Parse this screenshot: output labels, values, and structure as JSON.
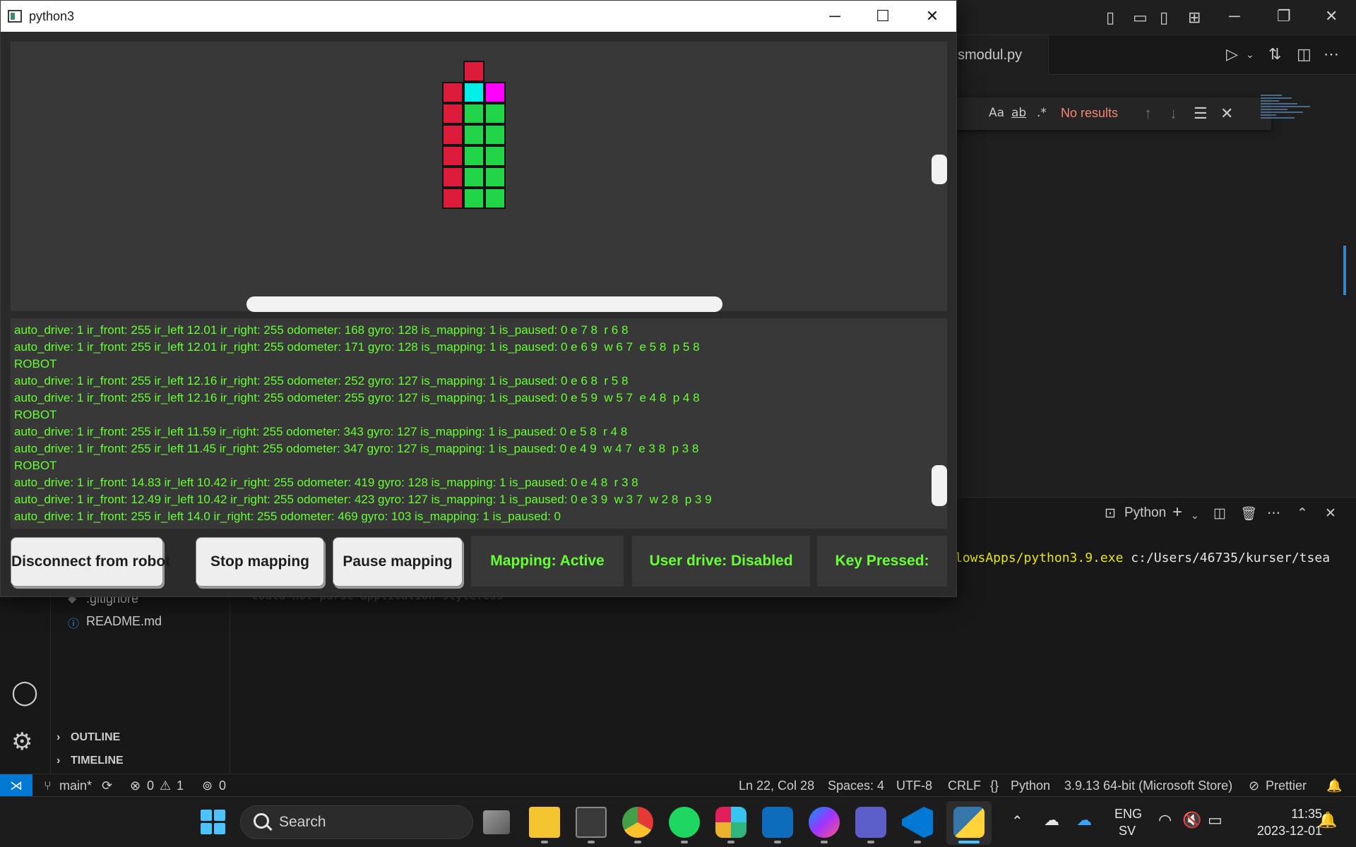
{
  "vscode": {
    "editor_tab": "smodul.py",
    "find": {
      "case_label": "Aa",
      "word_label": "ab",
      "regex_label": ".*",
      "no_results": "No results"
    },
    "explorer_files": [
      ".gitignore",
      "README.md"
    ],
    "sections": {
      "outline": "OUTLINE",
      "timeline": "TIMELINE"
    },
    "panel": {
      "shell_label": "Python",
      "cmd_path": "lowsApps/python3.9.exe",
      "cmd_arg": "c:/Users/46735/kurser/tsea",
      "faded_text": "could not parse application style.css"
    },
    "statusbar": {
      "branch": "main*",
      "errors": "0",
      "warnings": "1",
      "ports": "0",
      "position": "Ln 22, Col 28",
      "spaces": "Spaces: 4",
      "encoding": "UTF-8",
      "eol": "CRLF",
      "language": "Python",
      "interpreter": "3.9.13 64-bit (Microsoft Store)",
      "formatter": "Prettier"
    }
  },
  "taskbar": {
    "search_placeholder": "Search",
    "lang_1": "ENG",
    "lang_2": "SV",
    "time": "11:35",
    "date": "2023-12-01"
  },
  "pywin": {
    "title": "python3",
    "log_lines": [
      "auto_drive: 1 ir_front: 255 ir_left 12.01 ir_right: 255 odometer: 168 gyro: 128 is_mapping: 1 is_paused: 0 e 7 8  r 6 8",
      "auto_drive: 1 ir_front: 255 ir_left 12.01 ir_right: 255 odometer: 171 gyro: 128 is_mapping: 1 is_paused: 0 e 6 9  w 6 7  e 5 8  p 5 8",
      "ROBOT",
      "auto_drive: 1 ir_front: 255 ir_left 12.16 ir_right: 255 odometer: 252 gyro: 127 is_mapping: 1 is_paused: 0 e 6 8  r 5 8",
      "auto_drive: 1 ir_front: 255 ir_left 12.16 ir_right: 255 odometer: 255 gyro: 127 is_mapping: 1 is_paused: 0 e 5 9  w 5 7  e 4 8  p 4 8",
      "ROBOT",
      "auto_drive: 1 ir_front: 255 ir_left 11.59 ir_right: 255 odometer: 343 gyro: 127 is_mapping: 1 is_paused: 0 e 5 8  r 4 8",
      "auto_drive: 1 ir_front: 255 ir_left 11.45 ir_right: 255 odometer: 347 gyro: 127 is_mapping: 1 is_paused: 0 e 4 9  w 4 7  e 3 8  p 3 8",
      "ROBOT",
      "auto_drive: 1 ir_front: 14.83 ir_left 10.42 ir_right: 255 odometer: 419 gyro: 128 is_mapping: 1 is_paused: 0 e 4 8  r 3 8",
      "auto_drive: 1 ir_front: 12.49 ir_left 10.42 ir_right: 255 odometer: 423 gyro: 127 is_mapping: 1 is_paused: 0 e 3 9  w 3 7  w 2 8  p 3 9",
      "auto_drive: 1 ir_front: 255 ir_left 14.0 ir_right: 255 odometer: 469 gyro: 103 is_mapping: 1 is_paused: 0"
    ],
    "buttons": {
      "disconnect": "Disconnect from robot",
      "stop_mapping": "Stop mapping",
      "pause_mapping": "Pause mapping"
    },
    "status": {
      "mapping": "Mapping: Active",
      "user_drive": "User drive: Disabled",
      "key_pressed": "Key Pressed:"
    },
    "map_colors": {
      "wall": "#dc1c3a",
      "empty": "#22d447",
      "robot": "#00f0e8",
      "target": "#ff00ff"
    }
  }
}
